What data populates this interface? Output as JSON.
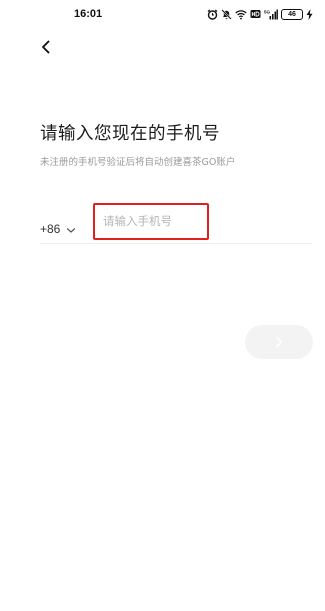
{
  "status_bar": {
    "time": "16:01",
    "battery": "46",
    "icons": [
      "alarm-icon",
      "mute-icon",
      "wifi-icon",
      "hd-icon",
      "signal-icon",
      "battery-icon",
      "charging-icon"
    ]
  },
  "nav": {
    "back_icon": "chevron-left-icon"
  },
  "login": {
    "title": "请输入您现在的手机号",
    "subtitle": "未注册的手机号验证后将自动创建喜茶GO账户",
    "country_code": "+86",
    "phone_placeholder": "请输入手机号",
    "phone_value": "",
    "next_icon": "chevron-right-icon"
  },
  "colors": {
    "highlight_border": "#e02020",
    "next_button_bg": "#f3f3f3",
    "subtitle_text": "#9a9a9a",
    "placeholder_text": "#b5b5b5"
  }
}
